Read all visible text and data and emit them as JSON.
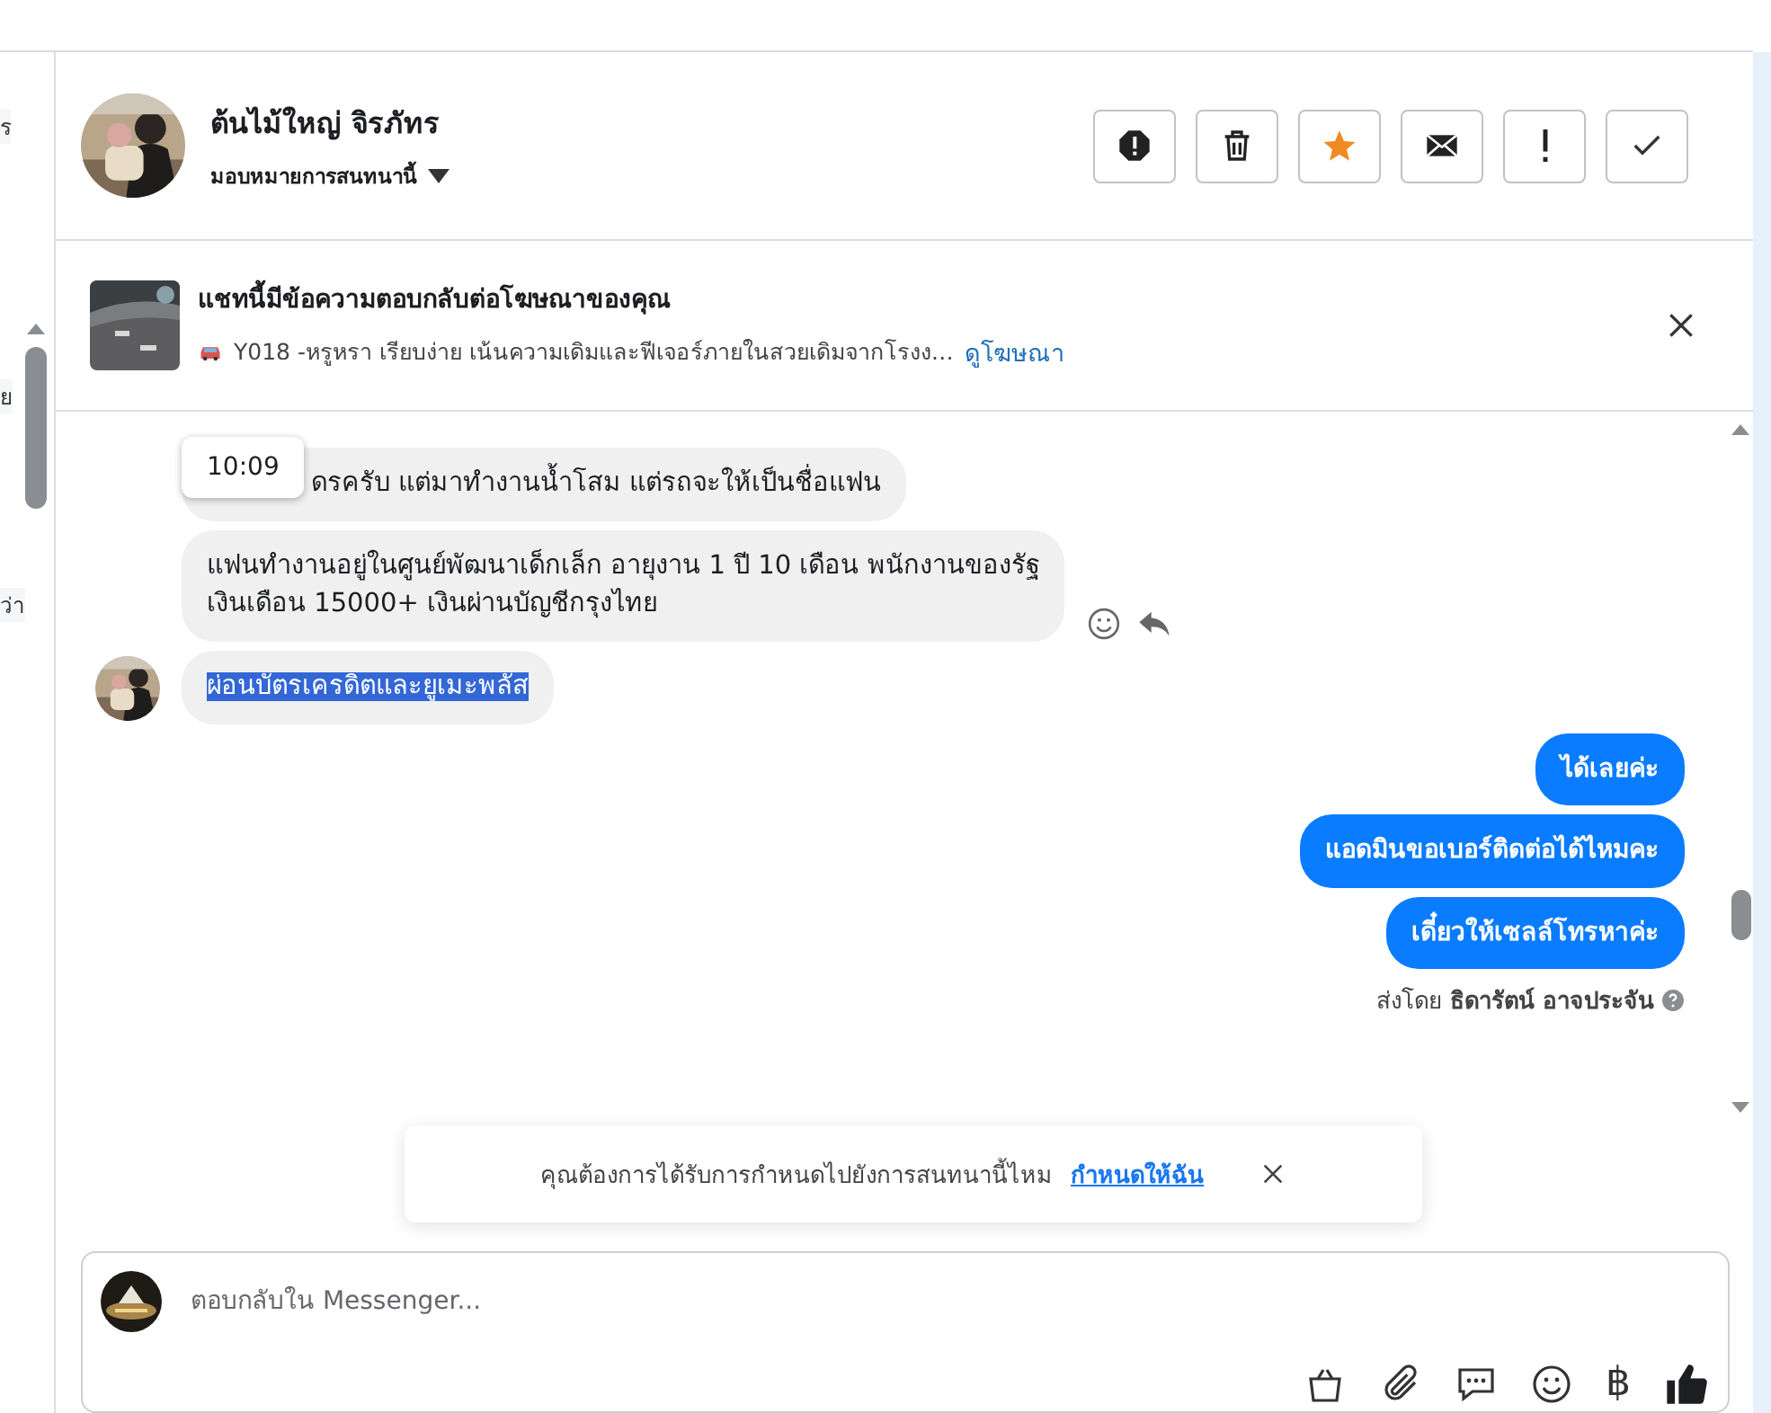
{
  "sidebar": {
    "fragments": [
      "ร",
      "ย",
      "ว่า"
    ]
  },
  "header": {
    "name": "ต้นไม้ใหญ่ จิรภัทร",
    "assign_label": "มอบหมายการสนทนานี้",
    "actions": [
      {
        "kind": "spam"
      },
      {
        "kind": "delete"
      },
      {
        "kind": "star",
        "on": true
      },
      {
        "kind": "mail"
      },
      {
        "kind": "alert"
      },
      {
        "kind": "done"
      }
    ]
  },
  "ad_banner": {
    "title": "แชทนี้มีข้อความตอบกลับต่อโฆษณาของคุณ",
    "description": "Y018 -หรูหรา เรียบง่าย เน้นความเดิมและฟีเจอร์ภายในสวยเดิมจากโรงง…",
    "link": "ดูโฆษณา"
  },
  "messages": [
    {
      "kind": "incoming",
      "text": "ดรครับ แต่มาทำงานน้ำโสม แต่รถจะให้เป็นชื่อแฟน",
      "timestamp": "10:09",
      "highlighted": false
    },
    {
      "kind": "incoming",
      "text": "แฟนทำงานอยู่ในศูนย์พัฒนาเด็กเล็ก อายุงาน 1 ปี 10 เดือน พนักงานของรัฐ\nเงินเดือน 15000+ เงินผ่านบัญชีกรุงไทย",
      "highlighted": false,
      "actions": true
    },
    {
      "kind": "incoming",
      "text": "ผ่อนบัตรเครดิตและยูเมะพลัส",
      "highlighted": true,
      "avatar": true
    },
    {
      "kind": "outgoing",
      "text": "ได้เลยค่ะ"
    },
    {
      "kind": "outgoing",
      "text": "แอดมินขอเบอร์ติดต่อได้ไหมคะ"
    },
    {
      "kind": "outgoing",
      "text": "เดี๋ยวให้เซลล์โทรหาค่ะ"
    }
  ],
  "sent_by": "ส่งโดย **ธิดารัตน์ อาจประจัน**",
  "assign_prompt": {
    "text": "คุณต้องการได้รับการกำหนดไปยังการสนทนานี้ไหม",
    "link": "กำหนดให้ฉัน"
  },
  "composer": {
    "placeholder": "ตอบกลับใน Messenger...",
    "tools": [
      {
        "kind": "bag"
      },
      {
        "kind": "attach"
      },
      {
        "kind": "chat"
      },
      {
        "kind": "emoji"
      },
      {
        "kind": "baht",
        "label": "฿"
      },
      {
        "kind": "like"
      }
    ]
  }
}
